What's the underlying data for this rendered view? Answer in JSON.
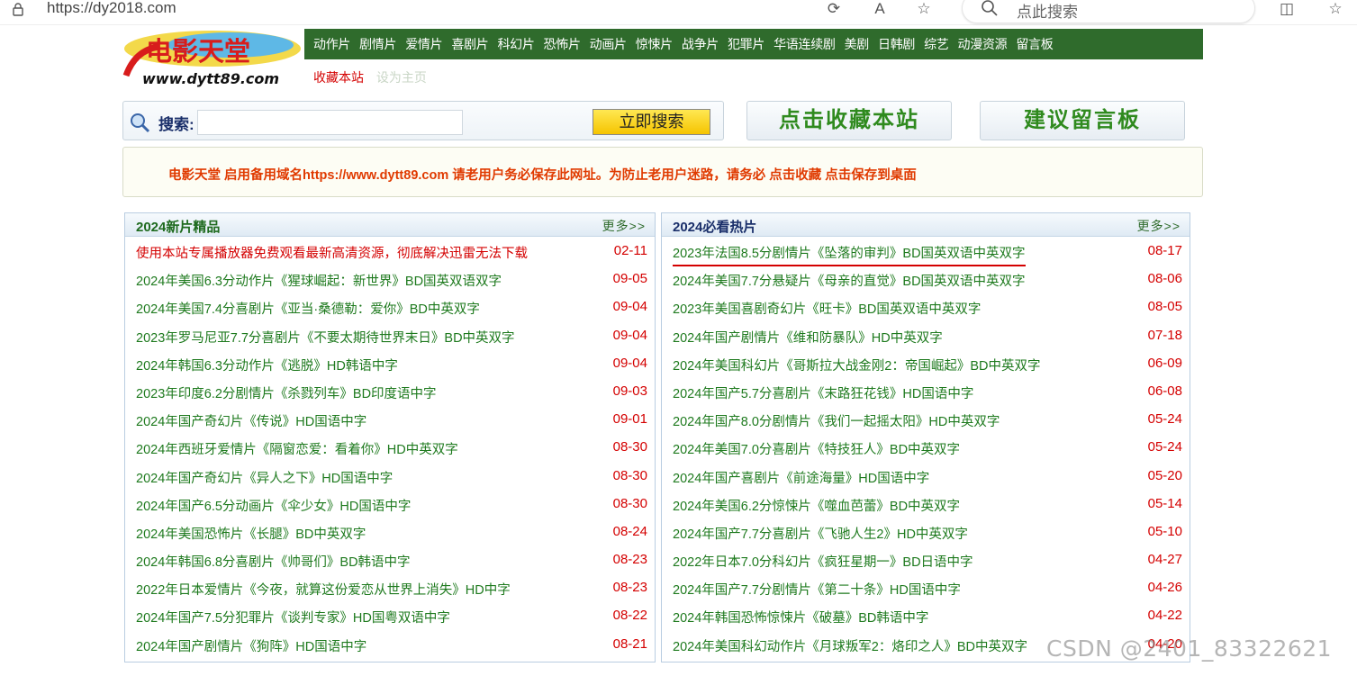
{
  "browser": {
    "url": "https://dy2018.com",
    "search_placeholder": "点此搜索"
  },
  "site": {
    "logo_text": "电影天堂",
    "logo_url": "www.dytt89.com",
    "nav": [
      "动作片",
      "剧情片",
      "爱情片",
      "喜剧片",
      "科幻片",
      "恐怖片",
      "动画片",
      "惊悚片",
      "战争片",
      "犯罪片",
      "华语连续剧",
      "美剧",
      "日韩剧",
      "综艺",
      "动漫资源",
      "留言板"
    ],
    "subnav_fav": "收藏本站",
    "subnav_home": "设为主页"
  },
  "search": {
    "label": "搜索:",
    "value": "",
    "button": "立即搜索"
  },
  "buttons": {
    "bookmark": "点击收藏本站",
    "feedback": "建议留言板"
  },
  "notice": "电影天堂 启用备用域名https://www.dytt89.com 请老用户务必保存此网址。为防止老用户迷路，请务必 点击收藏 点击保存到桌面",
  "left_panel": {
    "title": "2024新片精品",
    "more": "更多>>",
    "items": [
      {
        "title": "使用本站专属播放器免费观看最新高清资源，彻底解决迅雷无法下载",
        "date": "02-11"
      },
      {
        "title": "2024年美国6.3分动作片《猩球崛起：新世界》BD国英双语双字",
        "date": "09-05"
      },
      {
        "title": "2024年美国7.4分喜剧片《亚当·桑德勒：爱你》BD中英双字",
        "date": "09-04"
      },
      {
        "title": "2023年罗马尼亚7.7分喜剧片《不要太期待世界末日》BD中英双字",
        "date": "09-04"
      },
      {
        "title": "2024年韩国6.3分动作片《逃脱》HD韩语中字",
        "date": "09-04"
      },
      {
        "title": "2023年印度6.2分剧情片《杀戮列车》BD印度语中字",
        "date": "09-03"
      },
      {
        "title": "2024年国产奇幻片《传说》HD国语中字",
        "date": "09-01"
      },
      {
        "title": "2024年西班牙爱情片《隔窗恋爱：看着你》HD中英双字",
        "date": "08-30"
      },
      {
        "title": "2024年国产奇幻片《异人之下》HD国语中字",
        "date": "08-30"
      },
      {
        "title": "2024年国产6.5分动画片《伞少女》HD国语中字",
        "date": "08-30"
      },
      {
        "title": "2024年美国恐怖片《长腿》BD中英双字",
        "date": "08-24"
      },
      {
        "title": "2024年韩国6.8分喜剧片《帅哥们》BD韩语中字",
        "date": "08-23"
      },
      {
        "title": "2022年日本爱情片《今夜，就算这份爱恋从世界上消失》HD中字",
        "date": "08-23"
      },
      {
        "title": "2024年国产7.5分犯罪片《谈判专家》HD国粤双语中字",
        "date": "08-22"
      },
      {
        "title": "2024年国产剧情片《狗阵》HD国语中字",
        "date": "08-21"
      }
    ]
  },
  "right_panel": {
    "title": "2024必看热片",
    "more": "更多>>",
    "items": [
      {
        "title": "2023年法国8.5分剧情片《坠落的审判》BD国英双语中英双字",
        "date": "08-17"
      },
      {
        "title": "2024年美国7.7分悬疑片《母亲的直觉》BD国英双语中英双字",
        "date": "08-06"
      },
      {
        "title": "2023年美国喜剧奇幻片《旺卡》BD国英双语中英双字",
        "date": "08-05"
      },
      {
        "title": "2024年国产剧情片《维和防暴队》HD中英双字",
        "date": "07-18"
      },
      {
        "title": "2024年美国科幻片《哥斯拉大战金刚2：帝国崛起》BD中英双字",
        "date": "06-09"
      },
      {
        "title": "2024年国产5.7分喜剧片《末路狂花钱》HD国语中字",
        "date": "06-08"
      },
      {
        "title": "2024年国产8.0分剧情片《我们一起摇太阳》HD中英双字",
        "date": "05-24"
      },
      {
        "title": "2024年美国7.0分喜剧片《特技狂人》BD中英双字",
        "date": "05-24"
      },
      {
        "title": "2024年国产喜剧片《前途海量》HD国语中字",
        "date": "05-20"
      },
      {
        "title": "2024年美国6.2分惊悚片《噬血芭蕾》BD中英双字",
        "date": "05-14"
      },
      {
        "title": "2024年国产7.7分喜剧片《飞驰人生2》HD中英双字",
        "date": "05-10"
      },
      {
        "title": "2022年日本7.0分科幻片《疯狂星期一》BD日语中字",
        "date": "04-27"
      },
      {
        "title": "2024年国产7.7分剧情片《第二十条》HD国语中字",
        "date": "04-26"
      },
      {
        "title": "2024年韩国恐怖惊悚片《破墓》BD韩语中字",
        "date": "04-22"
      },
      {
        "title": "2024年美国科幻动作片《月球叛军2：烙印之人》BD中英双字",
        "date": "04-20"
      }
    ]
  },
  "watermark": "CSDN @2401_83322621",
  "colors": {
    "nav_bg": "#2f6b2c",
    "link_green": "#1e7a1e",
    "date_red": "#d40000",
    "button_yellow": "#f5c400"
  }
}
